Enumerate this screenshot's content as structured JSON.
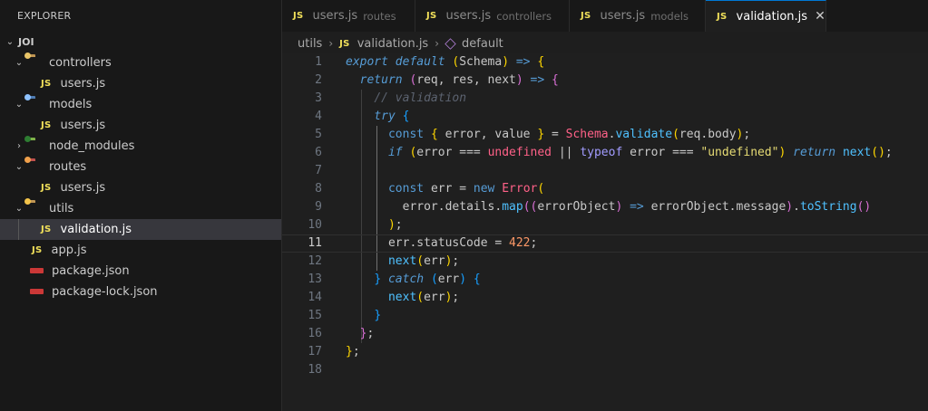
{
  "explorer": {
    "title": "EXPLORER",
    "root": "JOI",
    "items": [
      {
        "label": "controllers",
        "kind": "folder",
        "icon": "folder-controllers-icon",
        "expanded": true
      },
      {
        "label": "users.js",
        "kind": "js"
      },
      {
        "label": "models",
        "kind": "folder",
        "icon": "folder-models-icon",
        "expanded": true
      },
      {
        "label": "users.js",
        "kind": "js"
      },
      {
        "label": "node_modules",
        "kind": "folder",
        "icon": "folder-node-icon",
        "expanded": false
      },
      {
        "label": "routes",
        "kind": "folder",
        "icon": "folder-routes-icon",
        "expanded": true
      },
      {
        "label": "users.js",
        "kind": "js"
      },
      {
        "label": "utils",
        "kind": "folder",
        "icon": "folder-utils-icon",
        "expanded": true
      },
      {
        "label": "validation.js",
        "kind": "js",
        "selected": true
      },
      {
        "label": "app.js",
        "kind": "js"
      },
      {
        "label": "package.json",
        "kind": "npm"
      },
      {
        "label": "package-lock.json",
        "kind": "npm"
      }
    ]
  },
  "tabs": [
    {
      "badge": "JS",
      "label": "users.js",
      "desc": "routes",
      "active": false
    },
    {
      "badge": "JS",
      "label": "users.js",
      "desc": "controllers",
      "active": false
    },
    {
      "badge": "JS",
      "label": "users.js",
      "desc": "models",
      "active": false
    },
    {
      "badge": "JS",
      "label": "validation.js",
      "desc": "",
      "active": true,
      "close": "✕"
    }
  ],
  "breadcrumb": {
    "folder": "utils",
    "badge": "JS",
    "file": "validation.js",
    "symbol": "default"
  },
  "editor": {
    "current_line": 11,
    "line_numbers": [
      "1",
      "2",
      "3",
      "4",
      "5",
      "6",
      "7",
      "8",
      "9",
      "10",
      "11",
      "12",
      "13",
      "14",
      "15",
      "16",
      "17",
      "18"
    ]
  },
  "colors": {
    "accent": "#0078d4",
    "js_badge": "#f1e05a",
    "sidebar_bg": "#181818",
    "editor_bg": "#1f1f1f"
  }
}
